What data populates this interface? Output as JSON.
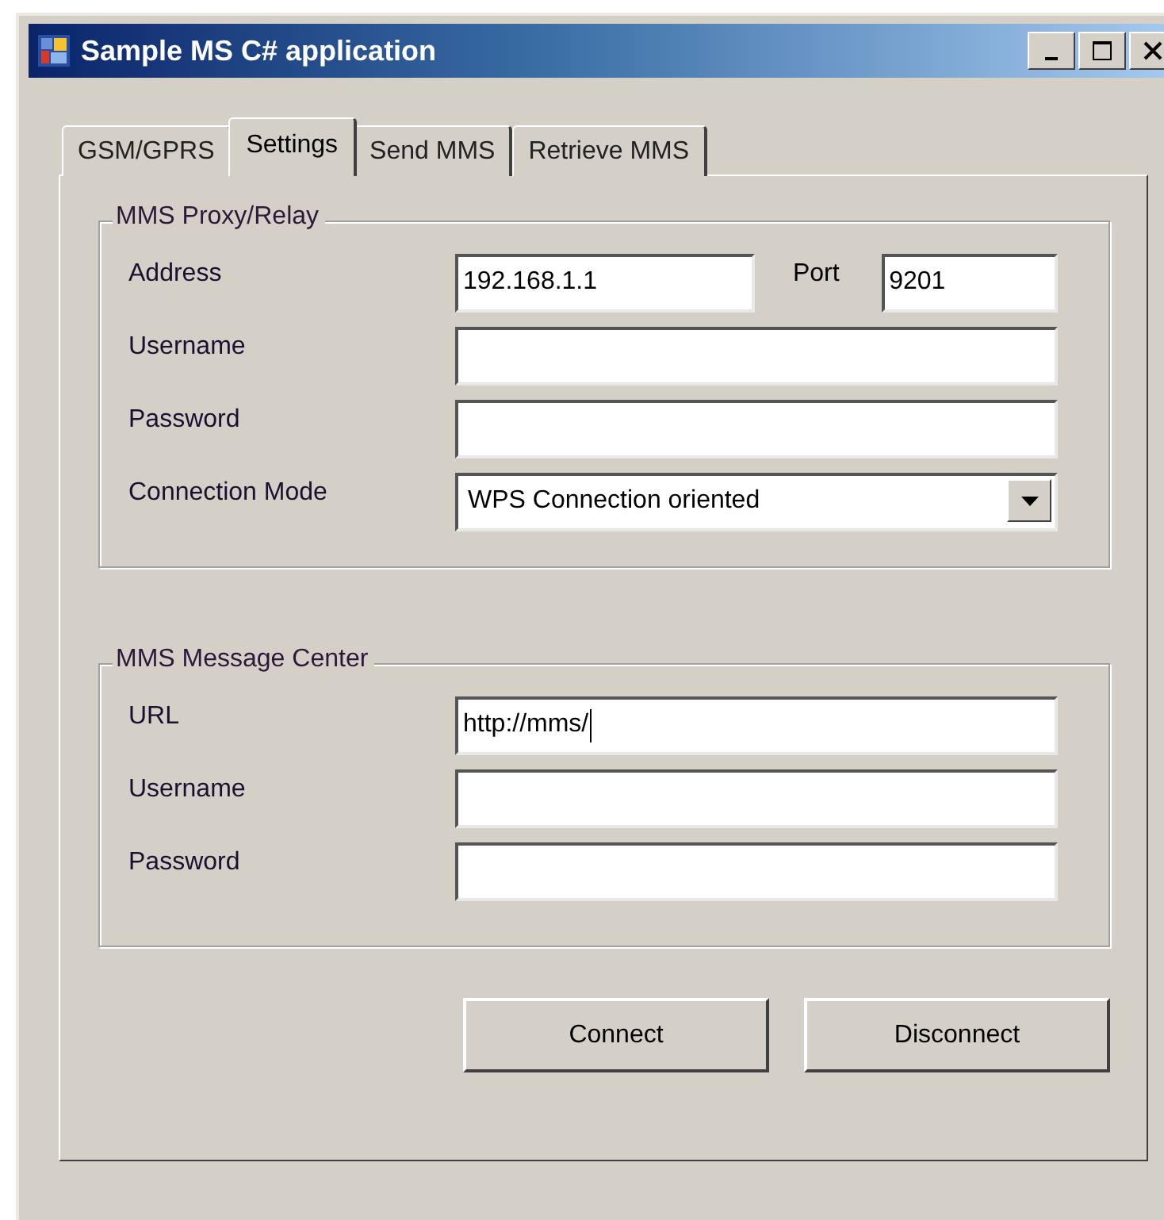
{
  "window": {
    "title": "Sample MS C# application"
  },
  "tabs": [
    {
      "label": "GSM/GPRS",
      "selected": false
    },
    {
      "label": "Settings",
      "selected": true
    },
    {
      "label": "Send MMS",
      "selected": false
    },
    {
      "label": "Retrieve MMS",
      "selected": false
    }
  ],
  "groups": [
    {
      "title": "MMS Proxy/Relay",
      "rows": [
        {
          "kind": "text",
          "label": "Address",
          "value": "192.168.1.1",
          "focused": false,
          "extra": {
            "label": "Port",
            "value": "9201"
          }
        },
        {
          "kind": "text",
          "label": "Username",
          "focused": false
        },
        {
          "kind": "text",
          "label": "Password",
          "focused": false
        },
        {
          "kind": "combo",
          "label": "Connection Mode",
          "value": "WPS Connection oriented"
        }
      ]
    },
    {
      "title": "MMS Message Center",
      "rows": [
        {
          "kind": "text",
          "label": "URL",
          "value": "http://mms/",
          "focused": true
        },
        {
          "kind": "text",
          "label": "Username",
          "focused": false
        },
        {
          "kind": "text",
          "label": "Password",
          "focused": false
        }
      ]
    }
  ],
  "buttons": [
    "Connect",
    "Disconnect"
  ]
}
